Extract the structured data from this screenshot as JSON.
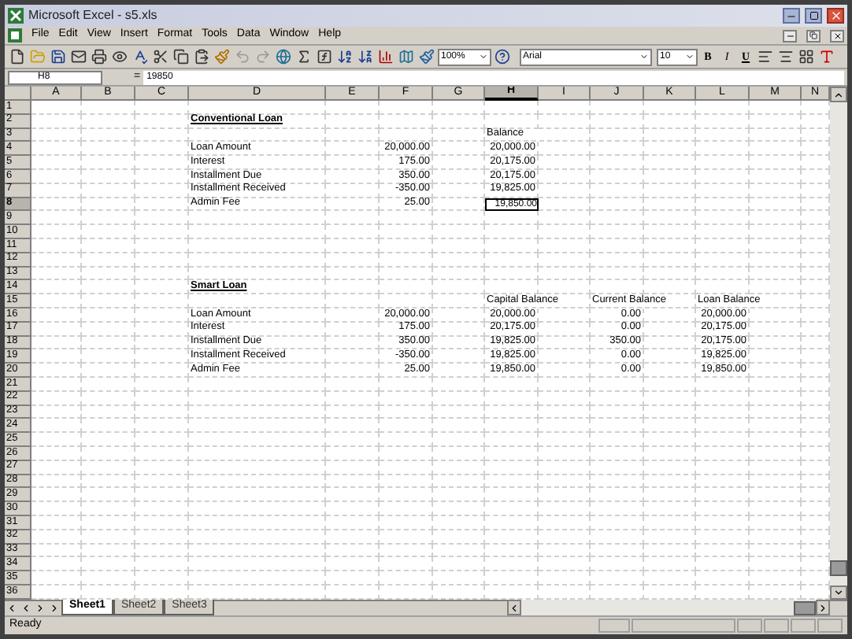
{
  "window": {
    "title": "Microsoft Excel - s5.xls"
  },
  "menu": [
    {
      "label": "File"
    },
    {
      "label": "Edit"
    },
    {
      "label": "View"
    },
    {
      "label": "Insert"
    },
    {
      "label": "Format"
    },
    {
      "label": "Tools"
    },
    {
      "label": "Data"
    },
    {
      "label": "Window"
    },
    {
      "label": "Help"
    }
  ],
  "toolbar": {
    "zoom": "100%",
    "font": "Arial",
    "size": "10",
    "format_buttons": [
      {
        "label": "B",
        "kind": "bold"
      },
      {
        "label": "I",
        "kind": "italic"
      },
      {
        "label": "U",
        "kind": "underline"
      }
    ]
  },
  "formula_bar": {
    "name_box": "H8",
    "equals": "=",
    "value": "19850"
  },
  "columns": [
    "A",
    "B",
    "C",
    "D",
    "E",
    "F",
    "G",
    "H",
    "I",
    "J",
    "K",
    "L",
    "M",
    "N"
  ],
  "rows": [
    {
      "label": "1",
      "cells": {}
    },
    {
      "label": "2",
      "cells": {
        "D": {
          "text": "Conventional Loan",
          "kind": "heading",
          "selected": false
        }
      }
    },
    {
      "label": "3",
      "cells": {
        "H": {
          "text": "Balance",
          "kind": "label",
          "selected": false
        }
      }
    },
    {
      "label": "4",
      "cells": {
        "D": {
          "text": "Loan Amount",
          "kind": "label",
          "selected": false
        },
        "F": {
          "text": "20,000.00",
          "kind": "number",
          "selected": false
        },
        "H": {
          "text": "20,000.00",
          "kind": "number",
          "selected": false
        }
      }
    },
    {
      "label": "5",
      "cells": {
        "D": {
          "text": "Interest",
          "kind": "label",
          "selected": false
        },
        "F": {
          "text": "175.00",
          "kind": "number",
          "selected": false
        },
        "H": {
          "text": "20,175.00",
          "kind": "number",
          "selected": false
        }
      }
    },
    {
      "label": "6",
      "cells": {
        "D": {
          "text": "Installment Due",
          "kind": "label",
          "selected": false
        },
        "F": {
          "text": "350.00",
          "kind": "number",
          "selected": false
        },
        "H": {
          "text": "20,175.00",
          "kind": "number",
          "selected": false
        }
      }
    },
    {
      "label": "7",
      "cells": {
        "D": {
          "text": "Installment Received",
          "kind": "label",
          "selected": false
        },
        "F": {
          "text": "-350.00",
          "kind": "number",
          "selected": false
        },
        "H": {
          "text": "19,825.00",
          "kind": "number",
          "selected": false
        }
      }
    },
    {
      "label": "8",
      "cells": {
        "D": {
          "text": "Admin Fee",
          "kind": "label",
          "selected": false
        },
        "F": {
          "text": "25.00",
          "kind": "number",
          "selected": false
        },
        "H": {
          "text": "19,850.00",
          "kind": "number",
          "selected": true
        }
      }
    },
    {
      "label": "9",
      "cells": {}
    },
    {
      "label": "10",
      "cells": {}
    },
    {
      "label": "11",
      "cells": {}
    },
    {
      "label": "12",
      "cells": {}
    },
    {
      "label": "13",
      "cells": {}
    },
    {
      "label": "14",
      "cells": {
        "D": {
          "text": "Smart Loan",
          "kind": "heading",
          "selected": false
        }
      }
    },
    {
      "label": "15",
      "cells": {
        "H": {
          "text": "Capital Balance",
          "kind": "label",
          "selected": false
        },
        "J": {
          "text": "Current Balance",
          "kind": "label",
          "selected": false
        },
        "L": {
          "text": "Loan Balance",
          "kind": "label",
          "selected": false
        }
      }
    },
    {
      "label": "16",
      "cells": {
        "D": {
          "text": "Loan Amount",
          "kind": "label",
          "selected": false
        },
        "F": {
          "text": "20,000.00",
          "kind": "number",
          "selected": false
        },
        "H": {
          "text": "20,000.00",
          "kind": "number",
          "selected": false
        },
        "J": {
          "text": "0.00",
          "kind": "number",
          "selected": false
        },
        "L": {
          "text": "20,000.00",
          "kind": "number",
          "selected": false
        }
      }
    },
    {
      "label": "17",
      "cells": {
        "D": {
          "text": "Interest",
          "kind": "label",
          "selected": false
        },
        "F": {
          "text": "175.00",
          "kind": "number",
          "selected": false
        },
        "H": {
          "text": "20,175.00",
          "kind": "number",
          "selected": false
        },
        "J": {
          "text": "0.00",
          "kind": "number",
          "selected": false
        },
        "L": {
          "text": "20,175.00",
          "kind": "number",
          "selected": false
        }
      }
    },
    {
      "label": "18",
      "cells": {
        "D": {
          "text": "Installment Due",
          "kind": "label",
          "selected": false
        },
        "F": {
          "text": "350.00",
          "kind": "number",
          "selected": false
        },
        "H": {
          "text": "19,825.00",
          "kind": "number",
          "selected": false
        },
        "J": {
          "text": "350.00",
          "kind": "number",
          "selected": false
        },
        "L": {
          "text": "20,175.00",
          "kind": "number",
          "selected": false
        }
      }
    },
    {
      "label": "19",
      "cells": {
        "D": {
          "text": "Installment Received",
          "kind": "label",
          "selected": false
        },
        "F": {
          "text": "-350.00",
          "kind": "number",
          "selected": false
        },
        "H": {
          "text": "19,825.00",
          "kind": "number",
          "selected": false
        },
        "J": {
          "text": "0.00",
          "kind": "number",
          "selected": false
        },
        "L": {
          "text": "19,825.00",
          "kind": "number",
          "selected": false
        }
      }
    },
    {
      "label": "20",
      "cells": {
        "D": {
          "text": "Admin Fee",
          "kind": "label",
          "selected": false
        },
        "F": {
          "text": "25.00",
          "kind": "number",
          "selected": false
        },
        "H": {
          "text": "19,850.00",
          "kind": "number",
          "selected": false
        },
        "J": {
          "text": "0.00",
          "kind": "number",
          "selected": false
        },
        "L": {
          "text": "19,850.00",
          "kind": "number",
          "selected": false
        }
      }
    },
    {
      "label": "21",
      "cells": {}
    },
    {
      "label": "22",
      "cells": {}
    },
    {
      "label": "23",
      "cells": {}
    },
    {
      "label": "24",
      "cells": {}
    },
    {
      "label": "25",
      "cells": {}
    },
    {
      "label": "26",
      "cells": {}
    },
    {
      "label": "27",
      "cells": {}
    },
    {
      "label": "28",
      "cells": {}
    },
    {
      "label": "29",
      "cells": {}
    },
    {
      "label": "30",
      "cells": {}
    },
    {
      "label": "31",
      "cells": {}
    },
    {
      "label": "32",
      "cells": {}
    },
    {
      "label": "33",
      "cells": {}
    },
    {
      "label": "34",
      "cells": {}
    },
    {
      "label": "35",
      "cells": {}
    },
    {
      "label": "36",
      "cells": {}
    }
  ],
  "sheet_tabs": [
    {
      "label": "Sheet1",
      "selected": true
    },
    {
      "label": "Sheet2",
      "selected": false
    },
    {
      "label": "Sheet3",
      "selected": false
    }
  ],
  "status_bar": {
    "text": "Ready"
  }
}
